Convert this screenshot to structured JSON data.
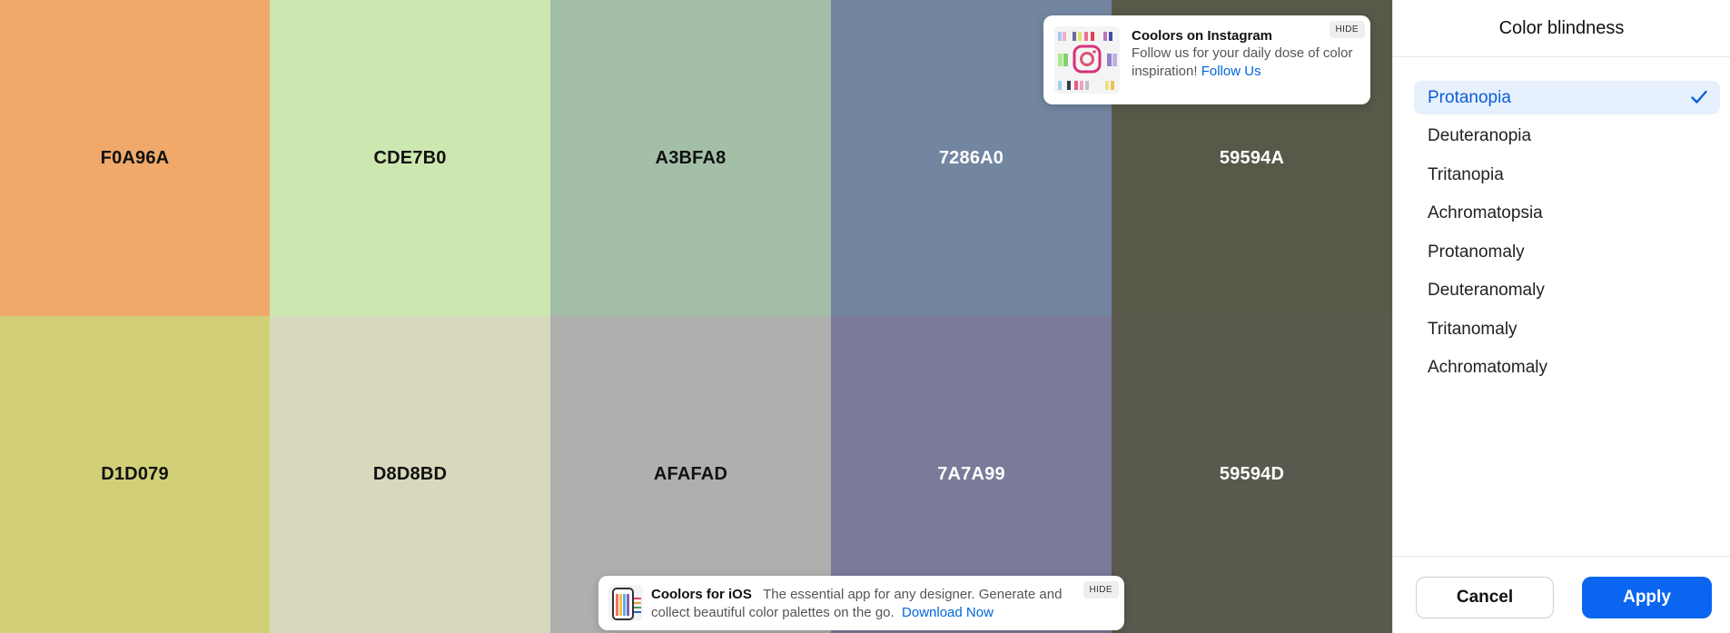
{
  "palette": {
    "original": [
      {
        "hex": "F0A96A",
        "color": "#F0A96A",
        "text_tone": "dark"
      },
      {
        "hex": "CDE7B0",
        "color": "#CDE7B0",
        "text_tone": "dark"
      },
      {
        "hex": "A3BFA8",
        "color": "#A3BFA8",
        "text_tone": "dark"
      },
      {
        "hex": "7286A0",
        "color": "#7286A0",
        "text_tone": "light"
      },
      {
        "hex": "59594A",
        "color": "#59594A",
        "text_tone": "light"
      }
    ],
    "simulated": [
      {
        "hex": "D1D079",
        "color": "#D1D079",
        "text_tone": "dark"
      },
      {
        "hex": "D8D8BD",
        "color": "#D8D8BD",
        "text_tone": "dark"
      },
      {
        "hex": "AFAFAD",
        "color": "#AFAFAD",
        "text_tone": "dark"
      },
      {
        "hex": "7A7A99",
        "color": "#7A7A99",
        "text_tone": "light"
      },
      {
        "hex": "59594D",
        "color": "#59594D",
        "text_tone": "light"
      }
    ]
  },
  "promo_instagram": {
    "title": "Coolors on Instagram",
    "text": "Follow us for your daily dose of color inspiration!",
    "link": "Follow Us",
    "hide_label": "HIDE",
    "icon": "instagram-icon"
  },
  "promo_ios": {
    "title": "Coolors for iOS",
    "text": "The essential app for any designer. Generate and collect beautiful color palettes on the go.",
    "link": "Download Now",
    "hide_label": "HIDE",
    "icon": "phone-app-icon"
  },
  "panel": {
    "title": "Color blindness",
    "options": [
      {
        "label": "Protanopia",
        "selected": true
      },
      {
        "label": "Deuteranopia",
        "selected": false
      },
      {
        "label": "Tritanopia",
        "selected": false
      },
      {
        "label": "Achromatopsia",
        "selected": false
      },
      {
        "label": "Protanomaly",
        "selected": false
      },
      {
        "label": "Deuteranomaly",
        "selected": false
      },
      {
        "label": "Tritanomaly",
        "selected": false
      },
      {
        "label": "Achromatomaly",
        "selected": false
      }
    ],
    "cancel_label": "Cancel",
    "apply_label": "Apply",
    "accent_color": "#0A66F0",
    "selected_icon": "check-icon"
  }
}
